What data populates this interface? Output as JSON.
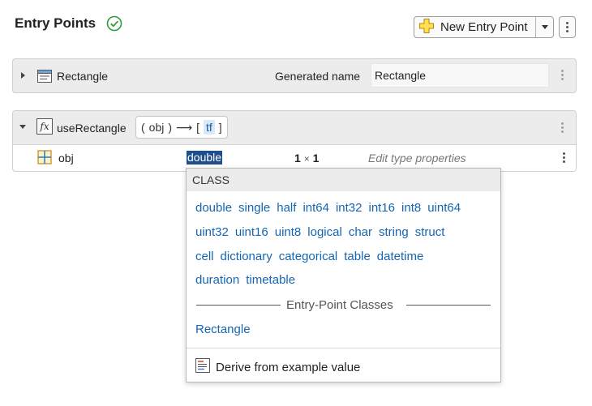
{
  "header": {
    "title": "Entry Points",
    "new_button_label": "New Entry Point"
  },
  "entry1": {
    "name": "Rectangle",
    "generated_name_label": "Generated name",
    "generated_name_value": "Rectangle"
  },
  "entry2": {
    "name": "useRectangle",
    "signature": {
      "open": "(",
      "input": "obj",
      "close": ")",
      "arrow": "⟶",
      "lb": "[",
      "output": "tf",
      "rb": "]"
    }
  },
  "argument": {
    "name": "obj",
    "type": "double",
    "size_rows": "1",
    "size_times": "×",
    "size_cols": "1",
    "edit_label": "Edit type properties"
  },
  "popup": {
    "header": "CLASS",
    "rows": [
      [
        "double",
        "single",
        "half",
        "int64",
        "int32",
        "int16",
        "int8",
        "uint64"
      ],
      [
        "uint32",
        "uint16",
        "uint8",
        "logical",
        "char",
        "string",
        "struct"
      ],
      [
        "cell",
        "dictionary",
        "categorical",
        "table",
        "datetime"
      ],
      [
        "duration",
        "timetable"
      ]
    ],
    "separator_label": "Entry-Point Classes",
    "entry_point_class": "Rectangle",
    "derive_label": "Derive from example value"
  },
  "colors": {
    "link": "#1466b3",
    "selection": "#1f4e8c",
    "success": "#2e9e3a",
    "header_bg": "#ececec"
  }
}
